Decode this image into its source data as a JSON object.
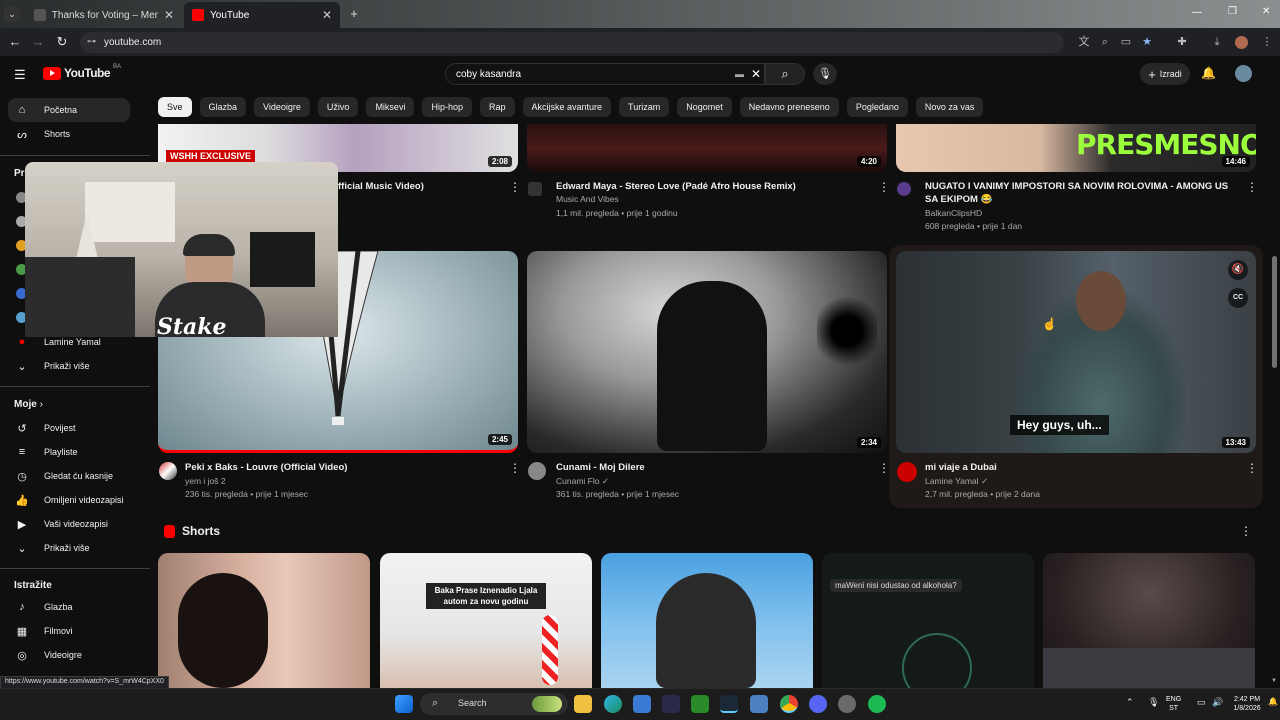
{
  "browser": {
    "tabs": [
      {
        "title": "Thanks for Voting – Men's TOP"
      },
      {
        "title": "YouTube"
      }
    ],
    "url": "youtube.com"
  },
  "header": {
    "logo_text": "YouTube",
    "logo_region": "BA",
    "search_value": "coby kasandra",
    "create_label": "Izradi"
  },
  "chips": [
    "Sve",
    "Glazba",
    "Videoigre",
    "Uživo",
    "Miksevi",
    "Hip-hop",
    "Rap",
    "Akcijske avanture",
    "Turizam",
    "Nogomet",
    "Nedavno preneseno",
    "Pogledano",
    "Novo za vas"
  ],
  "sidebar": {
    "home": "Početna",
    "shorts": "Shorts",
    "subs_heading": "Pr",
    "sub_channel": "Lamine Yamal",
    "show_more": "Prikaži više",
    "you_heading": "Moje",
    "you_items": [
      "Povijest",
      "Playliste",
      "Gledat ću kasnije",
      "Omiljeni videozapisi",
      "Vaši videozapisi",
      "Prikaži više"
    ],
    "explore_heading": "Istražite",
    "explore_items": [
      "Glazba",
      "Filmovi",
      "Videoigre"
    ]
  },
  "videos_top": [
    {
      "title": "fficial Music Video)",
      "duration": "2:08",
      "badge": "WSHH EXCLUSIVE"
    },
    {
      "title": "Edward Maya - Stereo Love (Padé Afro House Remix)",
      "channel": "Music And Vibes",
      "meta": "1,1 mil. pregleda • prije 1 godinu",
      "duration": "4:20"
    },
    {
      "title": "NUGATO I VANIMY IMPOSTORI SA NOVIM ROLOVIMA - AMONG US SA EKIPOM 😂",
      "channel": "BalkanClipsHD",
      "meta": "608 pregleda • prije 1 dan",
      "duration": "14:46",
      "overlay": "PRESMESNO"
    }
  ],
  "videos_mid": [
    {
      "title": "Peki x Baks - Louvre (Official Video)",
      "channel": "yem i još 2",
      "meta": "236 tis. pregleda • prije 1 mjesec",
      "duration": "2:45"
    },
    {
      "title": "Cunami - Moj Dilere",
      "channel": "Cunami Flo",
      "meta": "361 tis. pregleda • prije 1 mjesec",
      "duration": "2:34"
    },
    {
      "title": "mi viaje a Dubai",
      "channel": "Lamine Yamal",
      "meta": "2,7 mil. pregleda • prije 2 dana",
      "duration": "13:43",
      "caption": "Hey guys, uh..."
    }
  ],
  "shorts": {
    "heading": "Shorts",
    "items": [
      {
        "overlay": ""
      },
      {
        "overlay": "Baka Prase Iznenadio Ljala autom za novu godinu"
      },
      {
        "overlay": ""
      },
      {
        "overlay": "maWeni nisi odustao od alkohola?"
      },
      {
        "overlay": ""
      }
    ]
  },
  "webcam": {
    "watermark": "Stake"
  },
  "status_url": "https://www.youtube.com/watch?v=S_mrW4CpXX0",
  "taskbar": {
    "search": "Search",
    "lang1": "ENG",
    "lang2": "ST",
    "time": "2:42 PM",
    "date": "1/8/2026"
  },
  "colors": {
    "accent": "#ff0000",
    "bg": "#0f0f0f",
    "chip": "#272727"
  }
}
